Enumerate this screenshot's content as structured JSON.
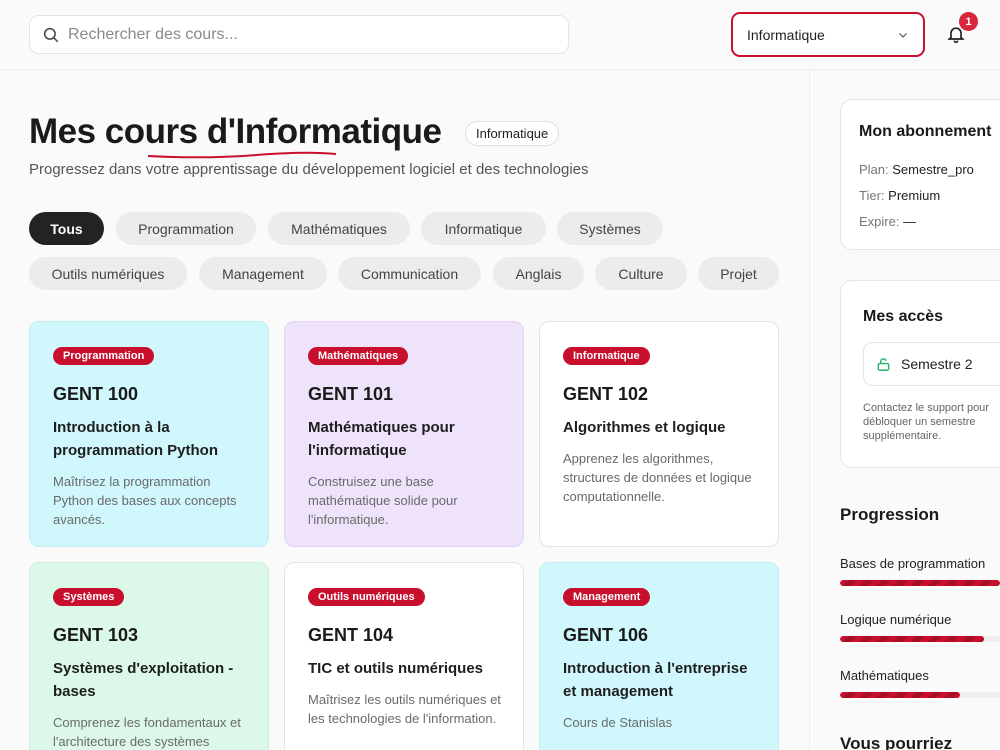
{
  "search": {
    "placeholder": "Rechercher des cours..."
  },
  "filter_select": {
    "value": "Informatique"
  },
  "notifications": {
    "count": "1"
  },
  "page": {
    "title": "Mes cours d'Informatique",
    "badge": "Informatique",
    "subtitle": "Progressez dans votre apprentissage du développement logiciel et des technologies"
  },
  "filters": [
    "Tous",
    "Programmation",
    "Mathématiques",
    "Informatique",
    "Systèmes",
    "Outils numériques",
    "Management",
    "Communication",
    "Anglais",
    "Culture",
    "Projet"
  ],
  "active_filter": "Tous",
  "courses": [
    {
      "category": "Programmation",
      "code": "GENT 100",
      "name": "Introduction à la programmation Python",
      "description": "Maîtrisez la programmation Python des bases aux concepts avancés.",
      "color": "#cff7fc"
    },
    {
      "category": "Mathématiques",
      "code": "GENT 101",
      "name": "Mathématiques pour l'informatique",
      "description": "Construisez une base mathématique solide pour l'informatique.",
      "color": "#efe3fb"
    },
    {
      "category": "Informatique",
      "code": "GENT 102",
      "name": "Algorithmes et logique",
      "description": "Apprenez les algorithmes, structures de données et logique computationnelle.",
      "color": "#ffffff"
    },
    {
      "category": "Systèmes",
      "code": "GENT 103",
      "name": "Systèmes d'exploitation - bases",
      "description": "Comprenez les fondamentaux et l'architecture des systèmes",
      "color": "#dcf8e8"
    },
    {
      "category": "Outils numériques",
      "code": "GENT 104",
      "name": "TIC et outils numériques",
      "description": "Maîtrisez les outils numériques et les technologies de l'information.",
      "color": "#ffffff"
    },
    {
      "category": "Management",
      "code": "GENT 106",
      "name": "Introduction à l'entreprise et management",
      "description": "Cours de Stanislas",
      "color": "#cff7fc"
    }
  ],
  "subscription": {
    "title": "Mon abonnement",
    "plan_label": "Plan:",
    "plan_value": "Semestre_pro",
    "tier_label": "Tier:",
    "tier_value": "Premium",
    "expire_label": "Expire:",
    "expire_value": "—"
  },
  "access": {
    "title": "Mes accès",
    "item": "Semestre 2",
    "note": "Contactez le support pour débloquer un semestre supplémentaire."
  },
  "progression": {
    "title": "Progression",
    "items": [
      {
        "label": "Bases de programmation",
        "progress": 1.0
      },
      {
        "label": "Logique numérique",
        "progress": 0.9
      },
      {
        "label": "Mathématiques",
        "progress": 0.75
      }
    ]
  },
  "suggestions": {
    "title": "Vous pourriez"
  }
}
